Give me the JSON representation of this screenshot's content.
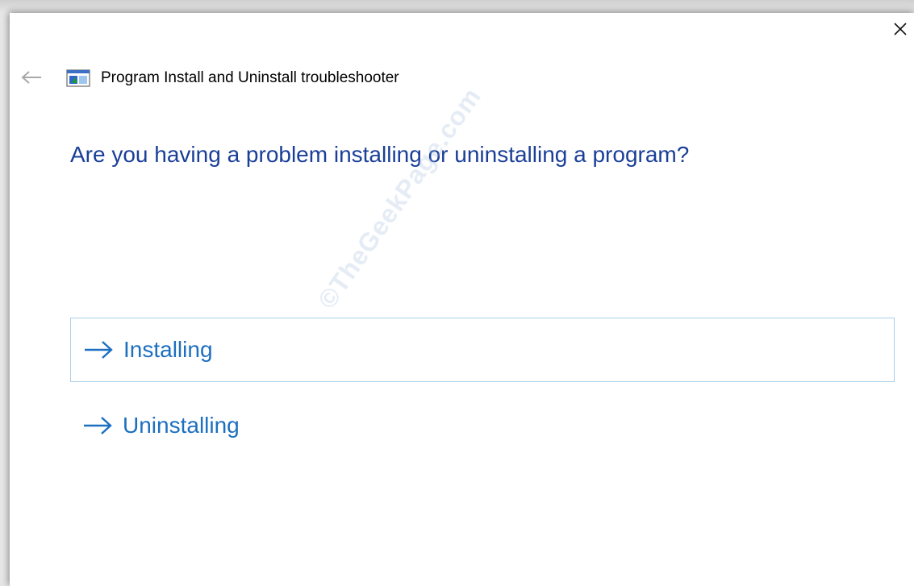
{
  "window": {
    "title": "Program Install and Uninstall troubleshooter",
    "close_icon": "close-icon",
    "back_icon": "back-arrow-icon",
    "app_icon": "troubleshooter-app-icon"
  },
  "main": {
    "question": "Are you having a problem installing or uninstalling a program?",
    "options": [
      {
        "label": "Installing",
        "icon": "right-arrow-icon",
        "selected": true
      },
      {
        "label": "Uninstalling",
        "icon": "right-arrow-icon",
        "selected": false
      }
    ]
  },
  "watermark": {
    "text": "©TheGeekPage.com"
  },
  "colors": {
    "heading": "#1a3f98",
    "link": "#1d6fc0",
    "selected_border": "#a9cfeb"
  }
}
